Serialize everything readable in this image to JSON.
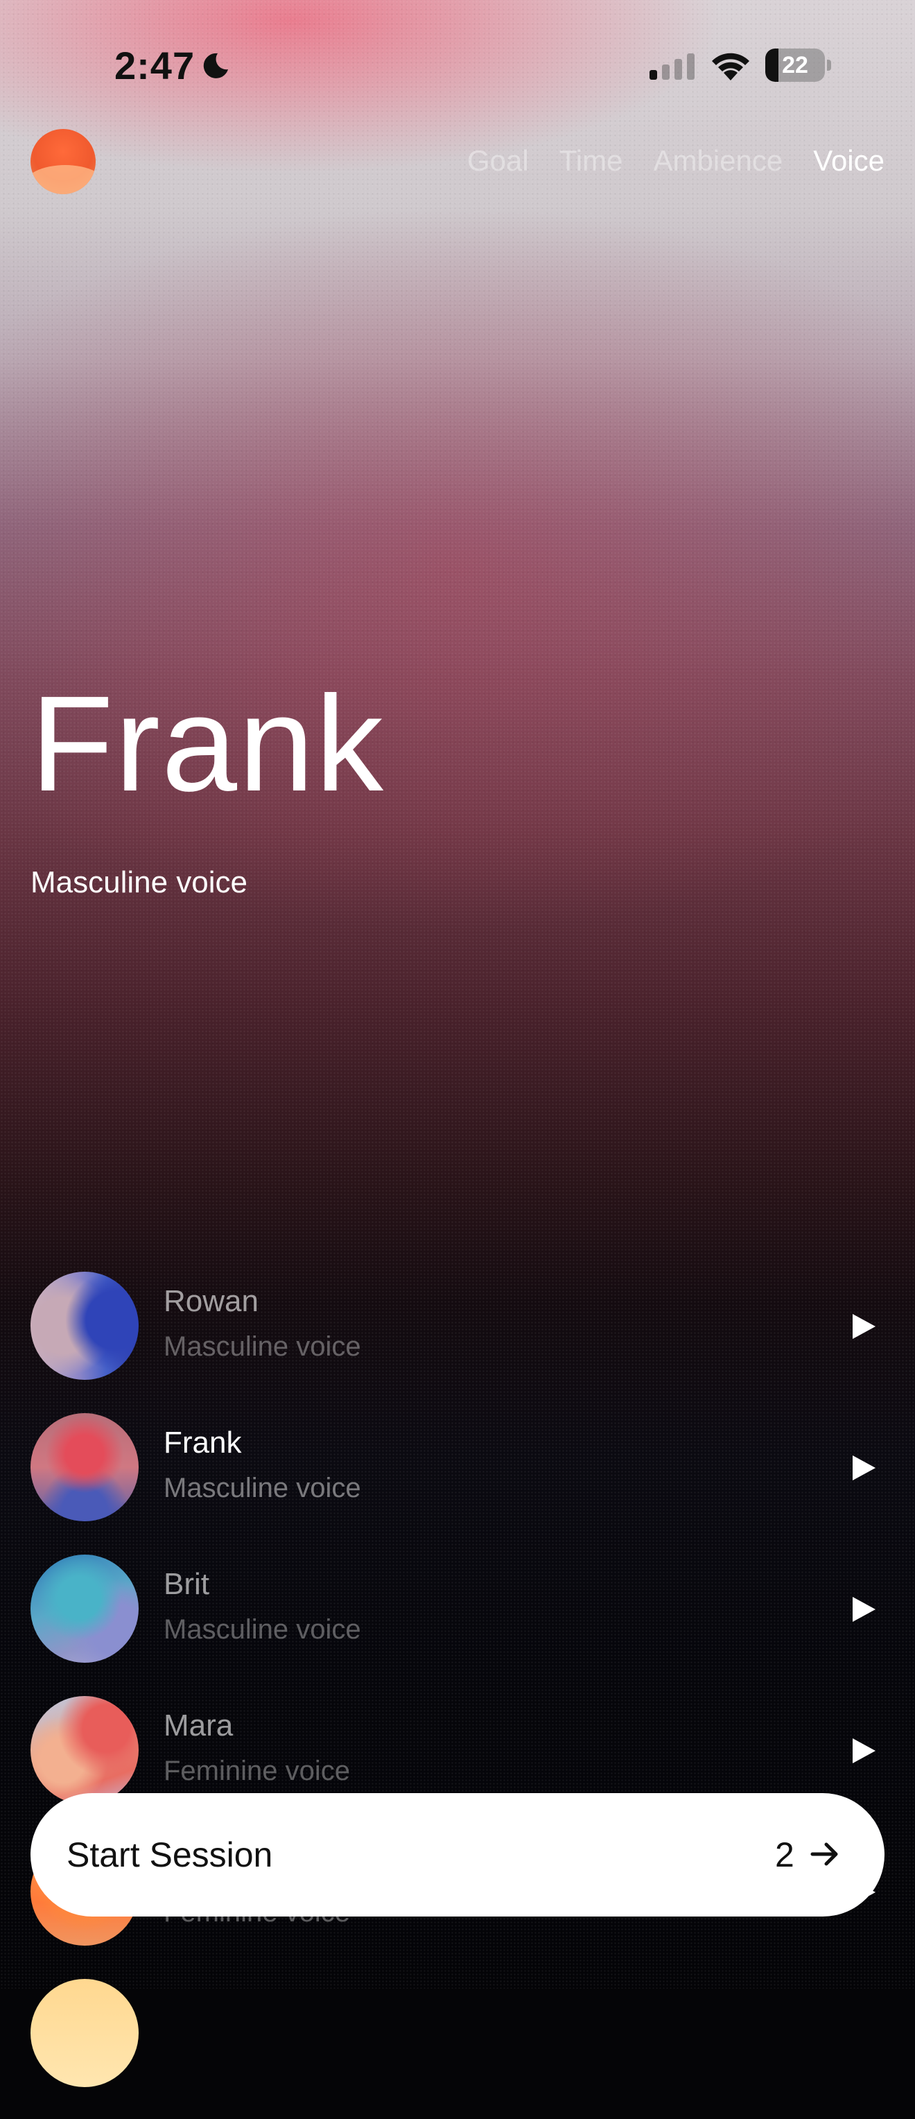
{
  "status_bar": {
    "time": "2:47",
    "battery": "22"
  },
  "nav": {
    "items": [
      {
        "label": "Goal"
      },
      {
        "label": "Time"
      },
      {
        "label": "Ambience"
      },
      {
        "label": "Voice"
      }
    ],
    "active": "Voice"
  },
  "hero": {
    "title": "Frank",
    "subtitle": "Masculine voice"
  },
  "voices": [
    {
      "name": "Rowan",
      "type": "Masculine voice"
    },
    {
      "name": "Frank",
      "type": "Masculine voice",
      "selected": true
    },
    {
      "name": "Brit",
      "type": "Masculine voice"
    },
    {
      "name": "Mara",
      "type": "Feminine voice"
    },
    {
      "name": "",
      "type": "Feminine voice"
    }
  ],
  "cta": {
    "label": "Start Session",
    "count": "2"
  },
  "colors": {
    "accent": "#F05A2E",
    "cta_background": "#FFFFFF"
  }
}
